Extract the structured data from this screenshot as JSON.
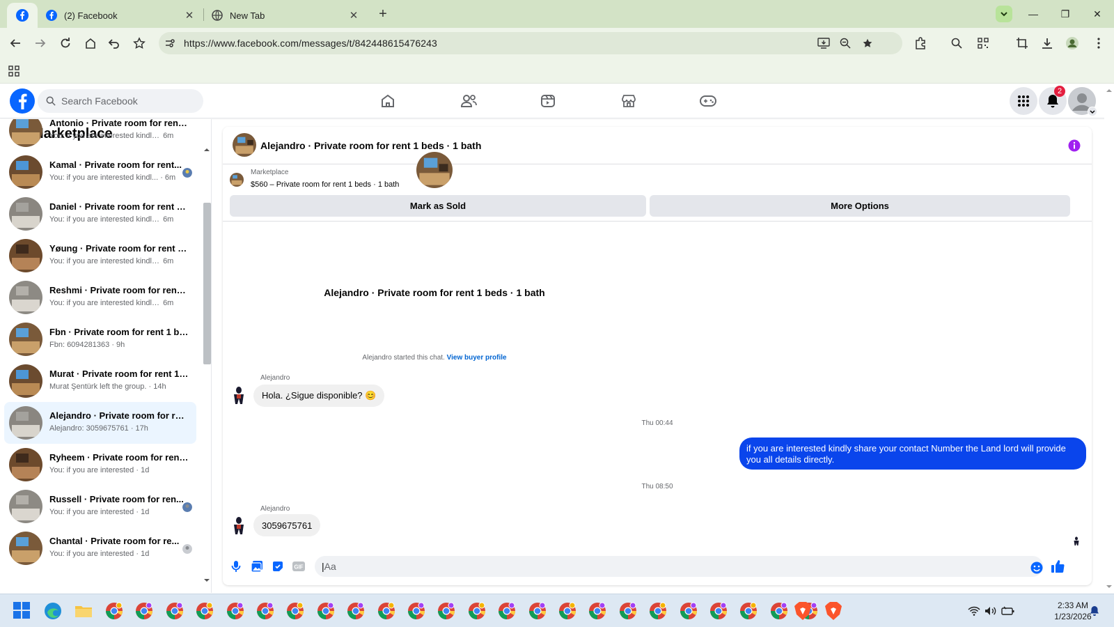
{
  "browser": {
    "tabs": [
      {
        "title": "(2) Facebook",
        "icon": "facebook-icon"
      },
      {
        "title": "New Tab",
        "icon": "globe-icon"
      }
    ],
    "url": "https://www.facebook.com/messages/t/842448615476243"
  },
  "facebook": {
    "search_placeholder": "Search Facebook",
    "notification_count": "2"
  },
  "sidebar": {
    "title": "Marketplace",
    "conversations": [
      {
        "name": "Antonio · Private room for rent ...",
        "snippet": "You: if you are interested kindly s...",
        "time": "6m",
        "active": false
      },
      {
        "name": "Kamal · Private room for rent...",
        "snippet": "You: if you are interested kindl...",
        "time": "· 6m",
        "active": false
      },
      {
        "name": "Daniel · Private room for rent 1 ...",
        "snippet": "You: if you are interested kindly s...",
        "time": "6m",
        "active": false
      },
      {
        "name": "Yøung · Private room for rent 1 ...",
        "snippet": "You: if you are interested kindly s...",
        "time": "6m",
        "active": false
      },
      {
        "name": "Reshmi · Private room for rent 1...",
        "snippet": "You: if you are interested kindly s...",
        "time": "6m",
        "active": false
      },
      {
        "name": "Fbn · Private room for rent 1 be...",
        "snippet": "Fbn: 6094281363",
        "time": "· 9h",
        "active": false
      },
      {
        "name": "Murat · Private room for rent 1 ...",
        "snippet": "Murat Şentürk left the group.",
        "time": "· 14h",
        "active": false
      },
      {
        "name": "Alejandro · Private room for ren...",
        "snippet": "Alejandro: 3059675761",
        "time": "· 17h",
        "active": true
      },
      {
        "name": "Ryheem · Private room for rent ...",
        "snippet": "You: if you are interested",
        "time": "· 1d",
        "active": false
      },
      {
        "name": "Russell · Private room for ren...",
        "snippet": "You: if you are interested",
        "time": "· 1d",
        "active": false
      },
      {
        "name": "Chantal · Private room for re...",
        "snippet": "You: if you are interested",
        "time": "· 1d",
        "active": false
      }
    ]
  },
  "chat": {
    "header_title": "Alejandro · Private room for rent 1 beds · 1 bath",
    "listing_source": "Marketplace",
    "listing_price": "$560 – Private room for rent 1 beds · 1 bath",
    "mark_sold": "Mark as Sold",
    "more_options": "More Options",
    "intro_name": "Alejandro · Private room for rent 1 beds · 1 bath",
    "started_text": "Alejandro started this chat.",
    "buyer_profile_link": "View buyer profile",
    "messages": [
      {
        "sender": "Alejandro",
        "text": "Hola. ¿Sigue disponible? 😊"
      },
      {
        "timestamp": "Thu 00:44"
      },
      {
        "outgoing_text": "if you are interested kindly share your contact Number the Land lord will provide you all details directly."
      },
      {
        "timestamp": "Thu 08:50"
      },
      {
        "sender": "Alejandro",
        "text": "3059675761"
      }
    ],
    "composer_placeholder": "Aa"
  },
  "taskbar": {
    "time": "2:33 AM",
    "date": "1/23/2026"
  }
}
